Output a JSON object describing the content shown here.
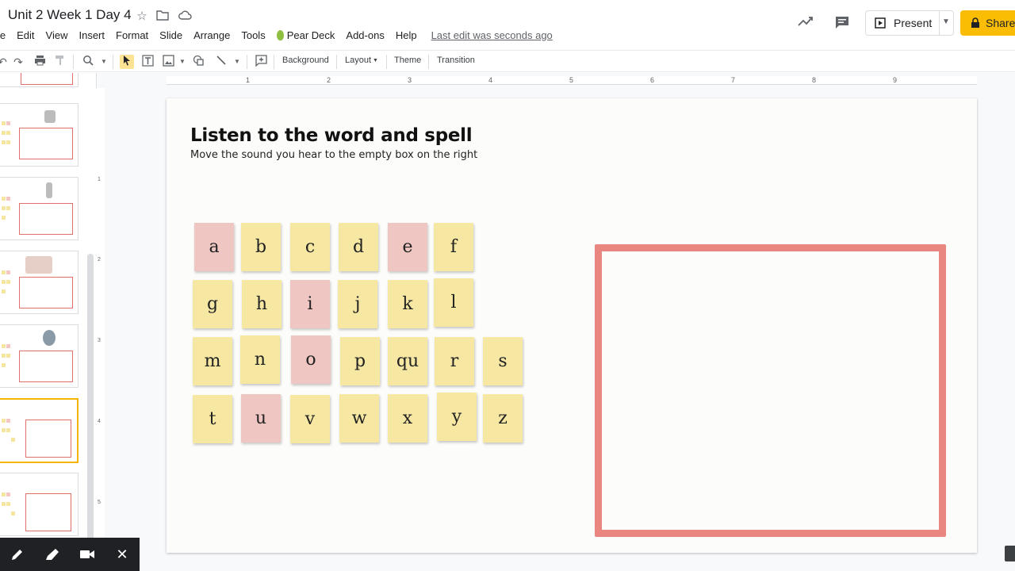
{
  "header": {
    "title": "Unit 2 Week 1 Day 4",
    "menu": [
      "le",
      "Edit",
      "View",
      "Insert",
      "Format",
      "Slide",
      "Arrange",
      "Tools",
      "Pear Deck",
      "Add-ons",
      "Help"
    ],
    "last_edit": "Last edit was seconds ago",
    "present_label": "Present",
    "share_label": "Share"
  },
  "toolbar": {
    "background_label": "Background",
    "layout_label": "Layout",
    "theme_label": "Theme",
    "transition_label": "Transition"
  },
  "ruler": {
    "horizontal": [
      "1",
      "2",
      "3",
      "4",
      "5",
      "6",
      "7",
      "8",
      "9"
    ],
    "vertical": [
      "1",
      "2",
      "3",
      "4",
      "5"
    ]
  },
  "slide": {
    "title": "Listen to the word and spell",
    "subtitle": "Move the sound you hear to the empty box on the right",
    "letter_tiles": [
      "a",
      "b",
      "c",
      "d",
      "e",
      "f",
      "g",
      "h",
      "i",
      "j",
      "k",
      "l",
      "m",
      "n",
      "o",
      "p",
      "qu",
      "r",
      "s",
      "t",
      "u",
      "v",
      "w",
      "x",
      "y",
      "z"
    ],
    "vowels": [
      "a",
      "e",
      "i",
      "o",
      "u"
    ]
  },
  "colors": {
    "consonant_tile": "#f6e7a3",
    "vowel_tile": "#efc6c2",
    "answer_box_border": "#e98680",
    "share_button": "#fbbc04",
    "selected_thumbnail_border": "#f4b400"
  }
}
